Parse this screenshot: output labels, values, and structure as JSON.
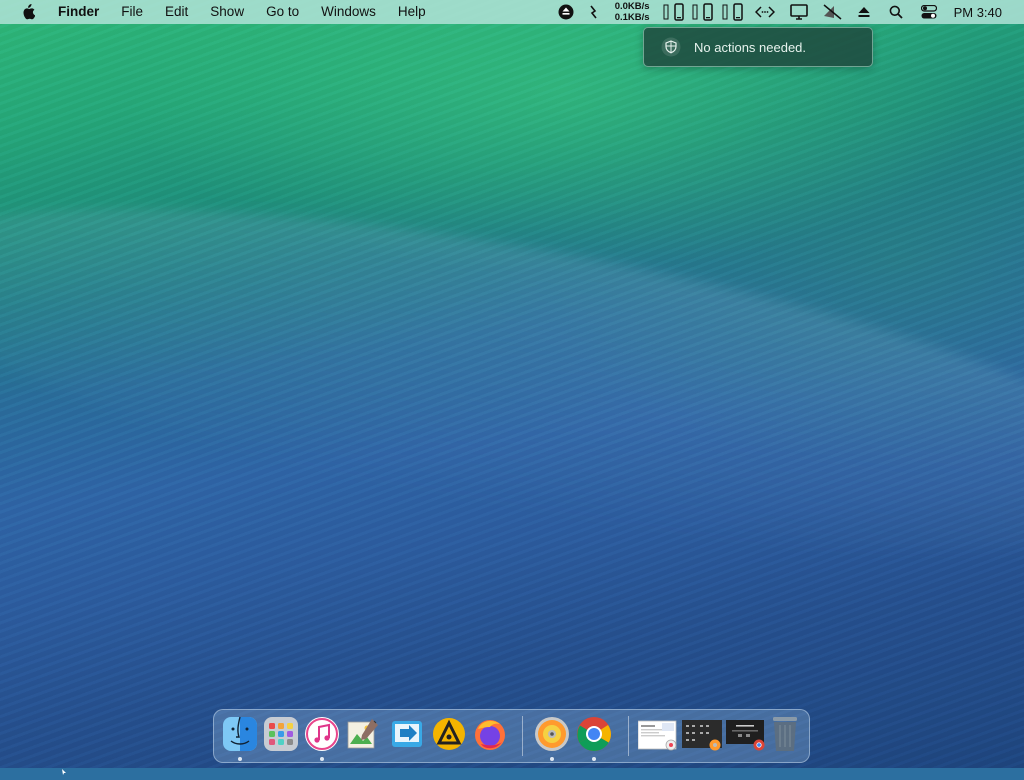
{
  "menubar": {
    "app_name": "Finder",
    "menus": [
      "File",
      "Edit",
      "Show",
      "Go to",
      "Windows",
      "Help"
    ],
    "net_speed": {
      "up": "0.0KB/s",
      "down": "0.1KB/s"
    },
    "clock": "PM 3:40"
  },
  "notification": {
    "message": "No actions needed."
  },
  "dock": {
    "apps": [
      "finder",
      "launchpad",
      "itunes",
      "preview-editor",
      "migration-assistant",
      "aimp",
      "firefox",
      "dvd-player",
      "chrome",
      "document-thumbnail",
      "window-thumbnail",
      "chrome-window-thumbnail",
      "trash"
    ]
  },
  "colors": {
    "menubar_bg": "#b0e2d6",
    "notification_bg": "#1e463c",
    "wallpaper_green": "#2fb879",
    "wallpaper_blue": "#2c5c9e"
  }
}
